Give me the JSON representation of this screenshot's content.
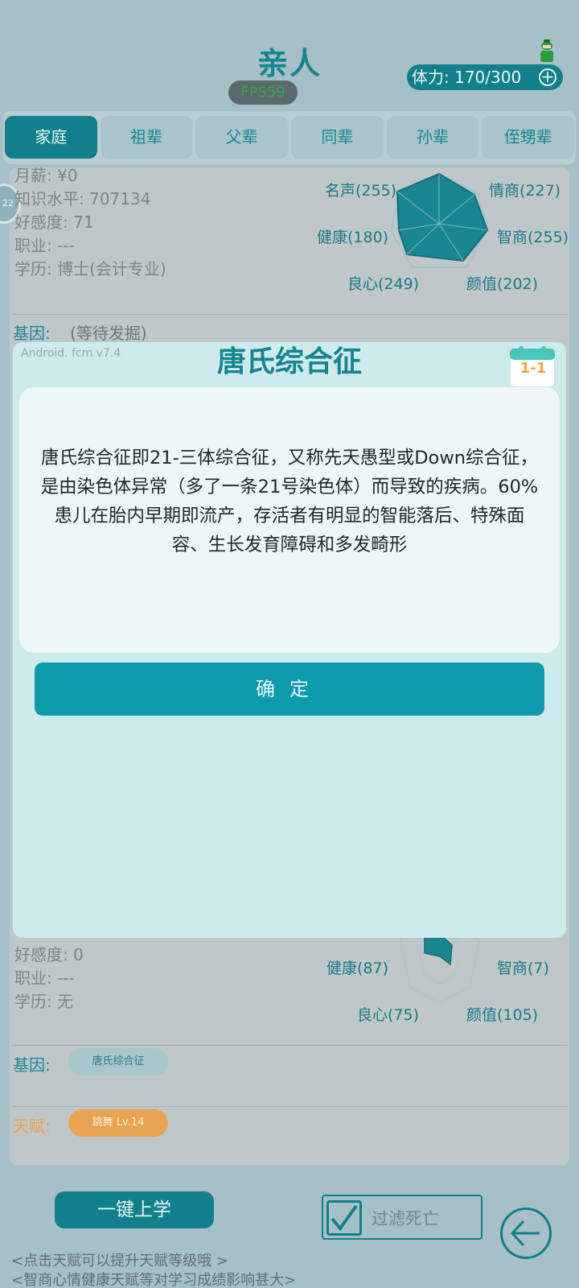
{
  "header": {
    "title": "亲人",
    "fps": "FPS59",
    "stamina": "体力: 170/300",
    "plus": "+"
  },
  "tabs": [
    "家庭",
    "祖辈",
    "父辈",
    "同辈",
    "孙辈",
    "侄甥辈"
  ],
  "side_badge": "22",
  "member1": {
    "lines": [
      "月薪: ¥0",
      "知识水平: 707134",
      "好感度: 71",
      "职业: ---",
      "学历: 博士(会计专业)"
    ],
    "gene_label": "基因:",
    "gene_value": "(等待发掘)",
    "radar": {
      "fame": "名声(255)",
      "eq": "情商(227)",
      "health": "健康(180)",
      "iq": "智商(255)",
      "conscience": "良心(249)",
      "looks": "颜值(202)"
    }
  },
  "member2": {
    "lines": [
      "好感度: 0",
      "职业: ---",
      "学历: 无"
    ],
    "gene_label": "基因:",
    "gene_pill": "唐氏综合征",
    "talent_label": "天赋:",
    "talent_pill": "跳舞 Lv.14",
    "radar": {
      "health": "健康(87)",
      "iq": "智商(7)",
      "conscience": "良心(75)",
      "looks": "颜值(105)"
    }
  },
  "bottom": {
    "school_button": "一键上学",
    "filter_label": "过滤死亡",
    "tip1": "<点击天赋可以提升天赋等级哦 >",
    "tip2": "<智商心情健康天赋等对学习成绩影响甚大>"
  },
  "dialog": {
    "version": "Android. fcm v7.4",
    "title": "唐氏综合征",
    "calendar": "1-1",
    "body": "唐氏综合征即21-三体综合征，又称先天愚型或Down综合征，是由染色体异常（多了一条21号染色体）而导致的疾病。60%患儿在胎内早期即流产，存活者有明显的智能落后、特殊面容、生长发育障碍和多发畸形",
    "confirm": "确定"
  },
  "colors": {
    "accent": "#127f8c",
    "dialog_bg": "#cdeaec",
    "talent": "#e8a450"
  }
}
